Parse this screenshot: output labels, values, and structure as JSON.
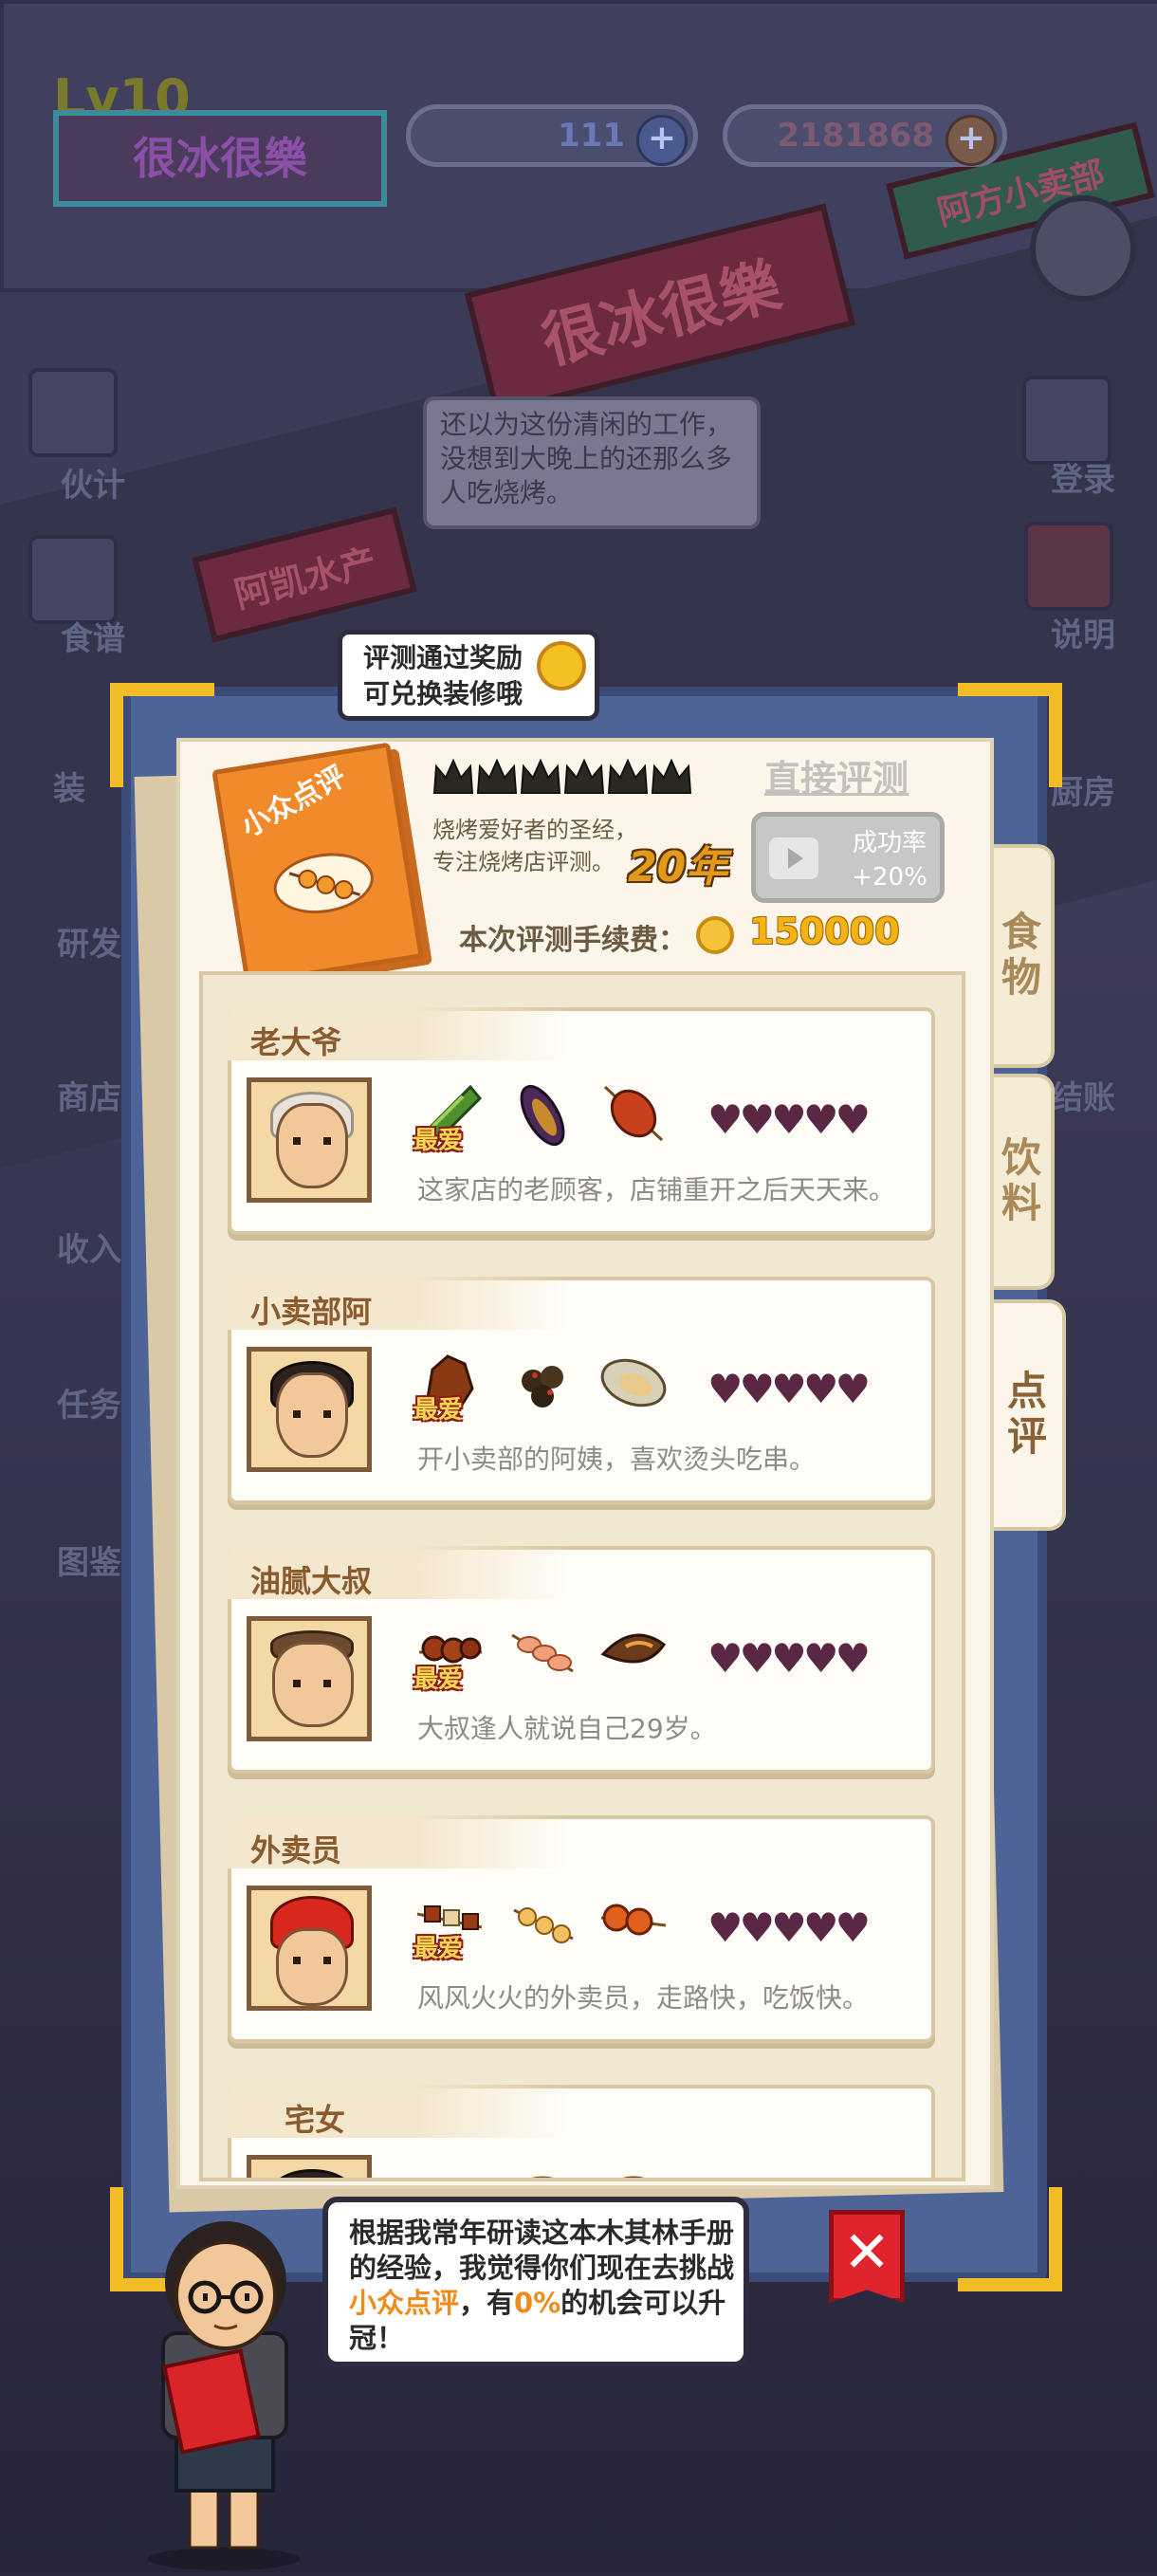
{
  "hud": {
    "level": "Lv10",
    "shop_name": "很冰很樂",
    "gems": "111",
    "coins": "2181868",
    "plus": "+"
  },
  "scene": {
    "sign_main": "很冰很樂",
    "sign_side": "阿方小卖部",
    "sign_left": "阿凯水产",
    "speech": "还以为这份清闲的工作，没想到大晚上的还那么多人吃烧烤。",
    "left_menu": [
      "伙计",
      "食谱",
      "装",
      "研发",
      "商店",
      "收入",
      "任务",
      "图鉴"
    ],
    "right_menu": [
      "登录",
      "说明",
      "厨房",
      "结账"
    ]
  },
  "reward_tip": {
    "line1": "评测通过奖励",
    "line2": "可兑换装修哦"
  },
  "review": {
    "book_title": "小众点评",
    "intro_line1": "烧烤爱好者的圣经，",
    "intro_line2": "专注烧烤店评测。",
    "years": "20年",
    "direct_label": "直接评测",
    "boost_line1": "成功率",
    "boost_line2": "+20%",
    "fee_label": "本次评测手续费：",
    "fee_value": "150000",
    "crowns": 6
  },
  "tabs": [
    {
      "label": "食物",
      "active": false
    },
    {
      "label": "饮料",
      "active": false
    },
    {
      "label": "点评",
      "active": true
    }
  ],
  "fav_label": "最爱",
  "hearts": "♥♥♥♥♥",
  "reviewers": [
    {
      "name": "老大爷",
      "desc": "这家店的老顾客，店铺重开之后天天来。"
    },
    {
      "name": "小卖部阿",
      "desc": "开小卖部的阿姨，喜欢烫头吃串。"
    },
    {
      "name": "油腻大叔",
      "desc": "大叔逢人就说自己29岁。"
    },
    {
      "name": "外卖员",
      "desc": "风风火火的外卖员，走路快，吃饭快。"
    },
    {
      "name": "宅女",
      "desc": ""
    }
  ],
  "dialog": {
    "part1": "根据我常年研读这本木其林手册的经验，我觉得你们现在去挑战",
    "highlight1": "小众点评",
    "part2": "，有",
    "highlight2": "0%",
    "part3": "的机会可以升冠！"
  },
  "close": "✕",
  "colors": {
    "accent_gold": "#f2bd24",
    "frame_blue": "#4e6396",
    "paper": "#fbf6e9",
    "heart": "#5a2745",
    "close_red": "#e0242e"
  }
}
